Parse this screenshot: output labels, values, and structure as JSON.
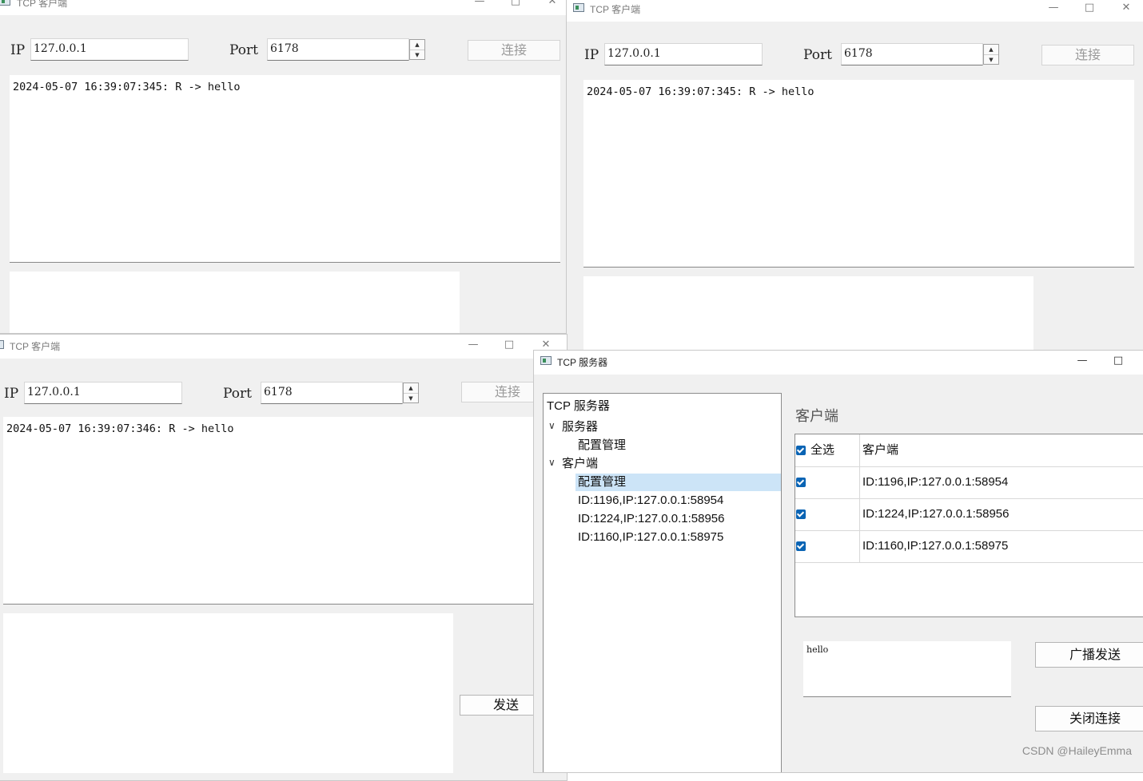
{
  "client_window_title": "TCP 客户端",
  "server_window_title": "TCP 服务器",
  "client_form": {
    "ip_label": "IP",
    "ip_value": "127.0.0.1",
    "port_label": "Port",
    "port_value": "6178",
    "connect_label": "连接",
    "send_label": "发送"
  },
  "clients": [
    {
      "log_line": "2024-05-07 16:39:07:345: R -> hello"
    },
    {
      "log_line": "2024-05-07 16:39:07:345: R -> hello"
    },
    {
      "log_line": "2024-05-07 16:39:07:346: R -> hello"
    }
  ],
  "window_controls": {
    "minimize": "—",
    "maximize": "□",
    "close": "✕"
  },
  "server": {
    "tree": {
      "root": "TCP 服务器",
      "server_group": "服务器",
      "server_config": "配置管理",
      "client_group": "客户端",
      "client_config": "配置管理",
      "client_items": [
        "ID:1196,IP:127.0.0.1:58954",
        "ID:1224,IP:127.0.0.1:58956",
        "ID:1160,IP:127.0.0.1:58975"
      ]
    },
    "panel_title": "客户端",
    "table": {
      "select_all_label": "全选",
      "column_client": "客户端",
      "rows": [
        {
          "checked": true,
          "client": "ID:1196,IP:127.0.0.1:58954"
        },
        {
          "checked": true,
          "client": "ID:1224,IP:127.0.0.1:58956"
        },
        {
          "checked": true,
          "client": "ID:1160,IP:127.0.0.1:58975"
        }
      ]
    },
    "message_text": "hello",
    "broadcast_label": "广播发送",
    "close_label": "关闭连接"
  },
  "watermark": "CSDN @HaileyEmma",
  "colors": {
    "checkbox": "#0a64b4",
    "selection": "#cce4f7"
  }
}
